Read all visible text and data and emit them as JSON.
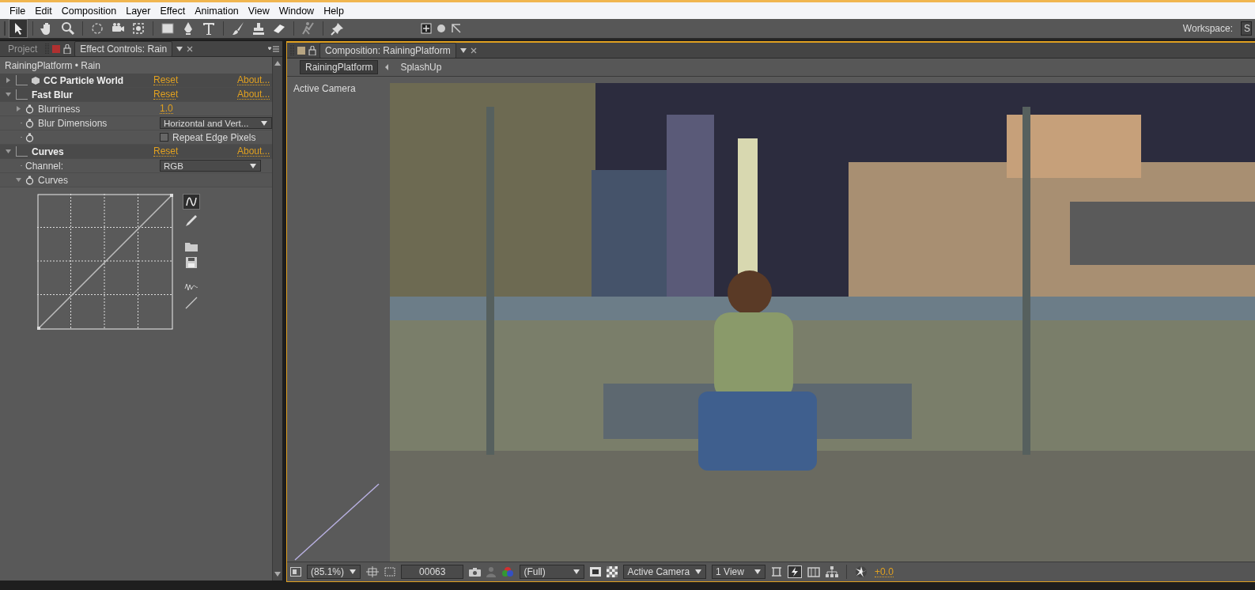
{
  "menu": [
    "File",
    "Edit",
    "Composition",
    "Layer",
    "Effect",
    "Animation",
    "View",
    "Window",
    "Help"
  ],
  "toolbar": {
    "workspace_label": "Workspace:",
    "workspace_value": "S"
  },
  "effect_controls": {
    "tabs": [
      {
        "label": "Project",
        "selected": false
      },
      {
        "label": "Effect Controls: Rain",
        "selected": true
      }
    ],
    "layer_path": "RainingPlatform • Rain",
    "effects": [
      {
        "name": "CC Particle World",
        "expanded": false,
        "reset": "Reset",
        "about": "About..."
      },
      {
        "name": "Fast Blur",
        "expanded": true,
        "reset": "Reset",
        "about": "About...",
        "properties": [
          {
            "kind": "value",
            "label": "Blurriness",
            "stopwatch": true,
            "value": "1.0"
          },
          {
            "kind": "dropdown",
            "label": "Blur Dimensions",
            "stopwatch": true,
            "value": "Horizontal and Vert..."
          },
          {
            "kind": "checkbox",
            "label": "Repeat Edge Pixels",
            "stopwatch": true,
            "checked": false
          }
        ]
      },
      {
        "name": "Curves",
        "expanded": true,
        "reset": "Reset",
        "about": "About...",
        "properties": [
          {
            "kind": "dropdown",
            "label": "Channel:",
            "stopwatch": false,
            "value": "RGB"
          },
          {
            "kind": "curves",
            "label": "Curves",
            "stopwatch": true
          }
        ]
      }
    ]
  },
  "composition": {
    "tab": "Composition: RainingPlatform",
    "breadcrumbs": [
      {
        "label": "RainingPlatform",
        "selected": true
      },
      {
        "label": "SplashUp",
        "selected": false
      }
    ],
    "viewer_label": "Active Camera",
    "footer": {
      "zoom": "(85.1%)",
      "timecode": "00063",
      "resolution": "(Full)",
      "view": "Active Camera",
      "layout": "1 View",
      "exposure": "+0.0"
    }
  }
}
